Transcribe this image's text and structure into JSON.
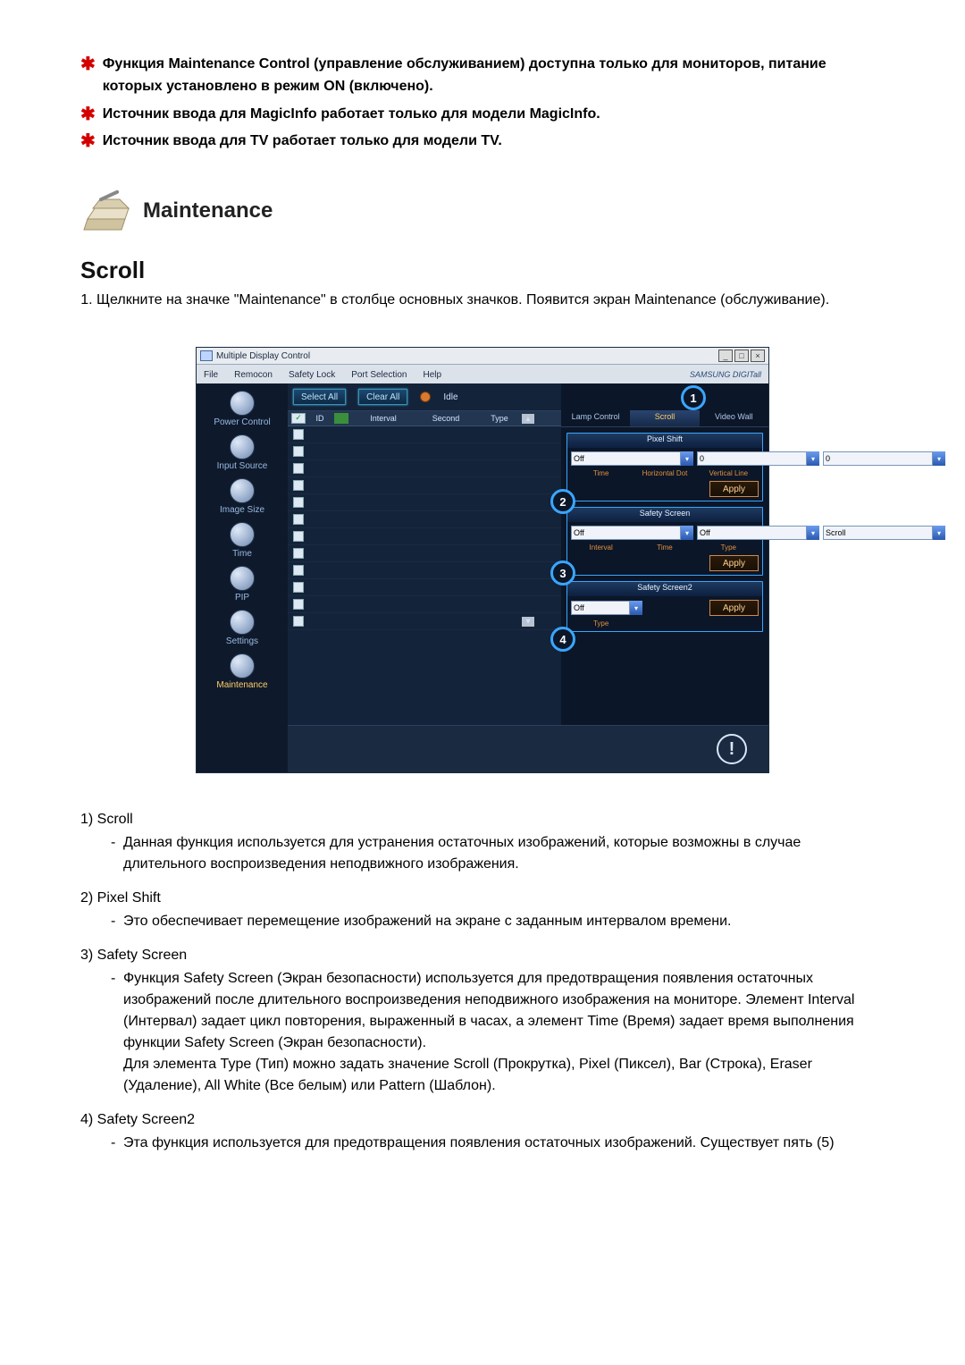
{
  "notes": [
    "Функция Maintenance Control (управление обслуживанием) доступна только для мониторов, питание которых установлено в режим ON (включено).",
    "Источник ввода для MagicInfo работает только для модели MagicInfo.",
    "Источник ввода для TV работает только для модели TV."
  ],
  "maint_heading": "Maintenance",
  "scroll_heading": "Scroll",
  "step1": "Щелкните на значке \"Maintenance\" в столбце основных значков. Появится экран Maintenance (обслуживание).",
  "shot": {
    "title": "Multiple Display Control",
    "menus": [
      "File",
      "Remocon",
      "Safety Lock",
      "Port Selection",
      "Help"
    ],
    "brand": "SAMSUNG DIGITall",
    "sidebar": [
      {
        "label": "Power Control"
      },
      {
        "label": "Input Source"
      },
      {
        "label": "Image Size"
      },
      {
        "label": "Time"
      },
      {
        "label": "PIP"
      },
      {
        "label": "Settings"
      },
      {
        "label": "Maintenance"
      }
    ],
    "toolbar": {
      "select_all": "Select All",
      "clear_all": "Clear All",
      "idle": "Idle"
    },
    "columns": {
      "id": "ID",
      "interval": "Interval",
      "second": "Second",
      "type": "Type"
    },
    "tabs": {
      "lamp": "Lamp Control",
      "scroll": "Scroll",
      "video": "Video Wall"
    },
    "pixel_shift": {
      "title": "Pixel Shift",
      "off_value": "Off",
      "h_value": "0",
      "v_value": "0",
      "lbl_time": "Time",
      "lbl_hdot": "Horizontal Dot",
      "lbl_vline": "Vertical Line",
      "apply": "Apply"
    },
    "safety_screen": {
      "title": "Safety Screen",
      "interval_value": "Off",
      "time_value": "Off",
      "type_value": "Scroll",
      "lbl_interval": "Interval",
      "lbl_time": "Time",
      "lbl_type": "Type",
      "apply": "Apply"
    },
    "safety_screen2": {
      "title": "Safety Screen2",
      "type_value": "Off",
      "lbl_type": "Type",
      "apply": "Apply"
    },
    "callouts": {
      "c1": "1",
      "c2": "2",
      "c3": "3",
      "c4": "4"
    }
  },
  "desc": {
    "i1": {
      "h": "1)  Scroll",
      "b": "Данная функция используется для устранения остаточных изображений, которые возможны в случае длительного воспроизведения неподвижного изображения."
    },
    "i2": {
      "h": "2)  Pixel Shift",
      "b": "Это обеспечивает перемещение изображений на экране с заданным интервалом времени."
    },
    "i3": {
      "h": "3)  Safety Screen",
      "b1": "Функция Safety Screen (Экран безопасности) используется для предотвращения появления остаточных изображений после длительного воспроизведения неподвижного изображения на мониторе. Элемент Interval (Интервал) задает цикл повторения, выраженный в часах, а элемент Time (Время) задает время выполнения функции Safety Screen (Экран безопасности).",
      "b2": "Для элемента Type (Тип) можно задать значение Scroll (Прокрутка), Pixel (Пиксел), Bar (Строка), Eraser (Удаление), All White (Все белым) или Pattern (Шаблон)."
    },
    "i4": {
      "h": "4)  Safety Screen2",
      "b": "Эта функция используется для предотвращения появления остаточных изображений. Существует пять (5)"
    }
  }
}
